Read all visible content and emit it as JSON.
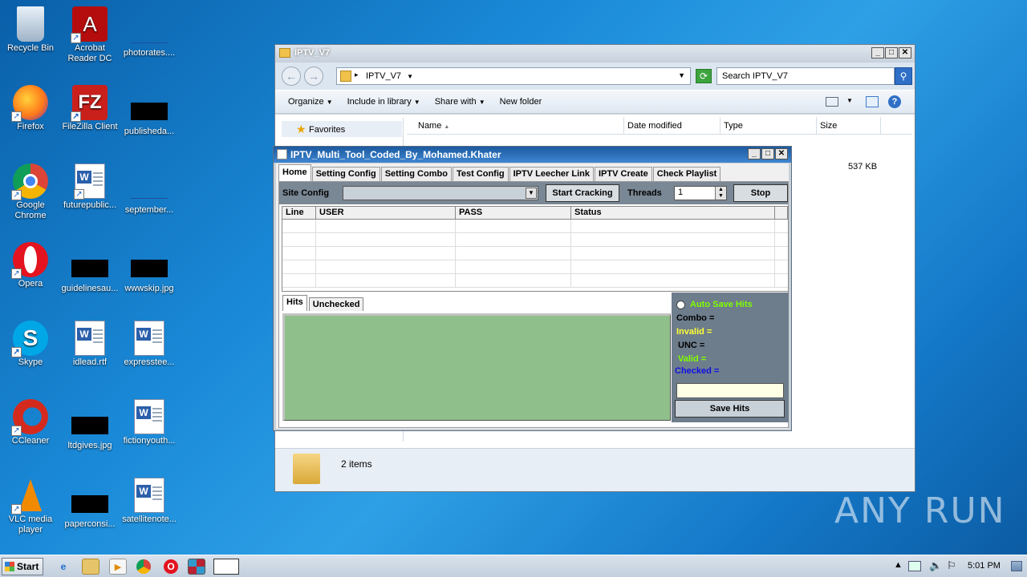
{
  "desktop": {
    "icons": [
      {
        "label": "Recycle Bin"
      },
      {
        "label": "Acrobat Reader DC"
      },
      {
        "label": "photorates...."
      },
      {
        "label": "Firefox"
      },
      {
        "label": "FileZilla Client"
      },
      {
        "label": "publisheda..."
      },
      {
        "label": "Google Chrome"
      },
      {
        "label": "futurepublic..."
      },
      {
        "label": "september..."
      },
      {
        "label": "Opera"
      },
      {
        "label": "guidelinesau..."
      },
      {
        "label": "wwwskip.jpg"
      },
      {
        "label": "Skype"
      },
      {
        "label": "idlead.rtf"
      },
      {
        "label": "expresstee..."
      },
      {
        "label": "CCleaner"
      },
      {
        "label": "ltdgives.jpg"
      },
      {
        "label": "fictionyouth..."
      },
      {
        "label": "VLC media player"
      },
      {
        "label": "paperconsi..."
      },
      {
        "label": "satellitenote..."
      }
    ]
  },
  "explorer": {
    "title": "IPTV_V7",
    "address": "IPTV_V7",
    "search_placeholder": "Search IPTV_V7",
    "commands": [
      "Organize",
      "Include in library",
      "Share with",
      "New folder"
    ],
    "nav_favorites": "Favorites",
    "columns": [
      "Name",
      "Date modified",
      "Type",
      "Size"
    ],
    "file_size": "537 KB",
    "status_items": "2 items"
  },
  "iptv": {
    "title": "IPTV_Multi_Tool_Coded_By_Mohamed.Khater",
    "tabs": [
      "Home",
      "Setting Config",
      "Setting Combo",
      "Test Config",
      "IPTV Leecher Link",
      "IPTV Create",
      "Check Playlist"
    ],
    "site_config_label": "Site Config",
    "start_button": "Start Cracking",
    "threads_label": "Threads",
    "threads_value": "1",
    "stop_button": "Stop",
    "grid_columns": [
      "Line",
      "USER",
      "PASS",
      "Status"
    ],
    "lower_tabs": [
      "Hits",
      "Unchecked"
    ],
    "auto_save": "Auto Save Hits",
    "combo": "Combo =",
    "invalid": "Invalid =",
    "unc": "UNC =",
    "valid": "Valid =",
    "checked": "Checked =",
    "save_hits": "Save Hits",
    "colors": {
      "auto_save": "#7fff00",
      "invalid": "#ffff33",
      "valid": "#7fff00",
      "checked": "#1010e0",
      "hits_box": "#8fbf8a"
    }
  },
  "taskbar": {
    "start": "Start",
    "clock": "5:01 PM"
  },
  "watermark": "ANY RUN"
}
